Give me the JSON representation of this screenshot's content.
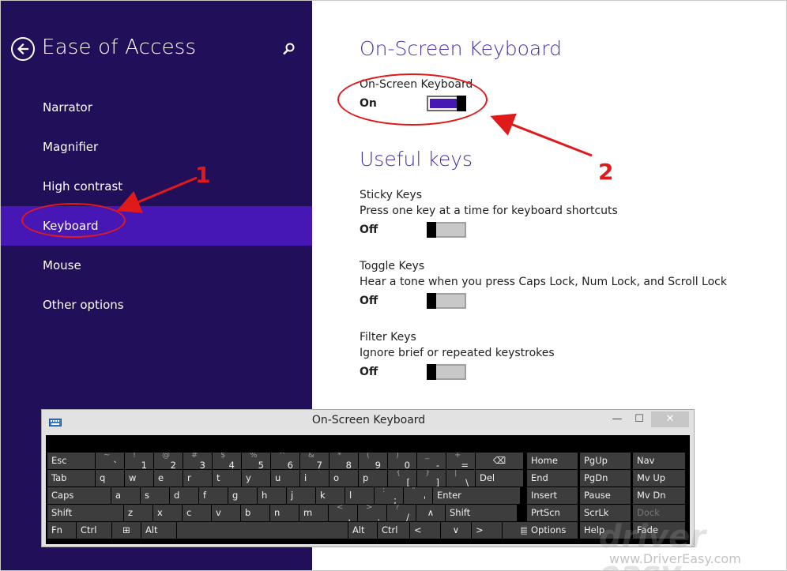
{
  "left_pane": {
    "title": "Ease of Access",
    "nav": [
      {
        "label": "Narrator"
      },
      {
        "label": "Magnifier"
      },
      {
        "label": "High contrast"
      },
      {
        "label": "Keyboard",
        "selected": true
      },
      {
        "label": "Mouse"
      },
      {
        "label": "Other options"
      }
    ]
  },
  "right_pane": {
    "osk_section": {
      "title": "On-Screen Keyboard",
      "label": "On-Screen Keyboard",
      "state": "On"
    },
    "useful_keys": {
      "title": "Useful keys",
      "items": [
        {
          "label": "Sticky Keys",
          "desc": "Press one key at a time for keyboard shortcuts",
          "state": "Off"
        },
        {
          "label": "Toggle Keys",
          "desc": "Hear a tone when you press Caps Lock, Num Lock, and Scroll Lock",
          "state": "Off"
        },
        {
          "label": "Filter Keys",
          "desc": "Ignore brief or repeated keystrokes",
          "state": "Off"
        }
      ]
    }
  },
  "osk_window": {
    "title": "On-Screen Keyboard",
    "rows": [
      [
        {
          "t": "Esc"
        },
        {
          "s": "~",
          "p": "`"
        },
        {
          "s": "!",
          "p": "1"
        },
        {
          "s": "@",
          "p": "2"
        },
        {
          "s": "#",
          "p": "3"
        },
        {
          "s": "$",
          "p": "4"
        },
        {
          "s": "%",
          "p": "5"
        },
        {
          "s": "^",
          "p": "6"
        },
        {
          "s": "&",
          "p": "7"
        },
        {
          "s": "*",
          "p": "8"
        },
        {
          "s": "(",
          "p": "9"
        },
        {
          "s": ")",
          "p": "0"
        },
        {
          "s": "_",
          "p": "-"
        },
        {
          "s": "+",
          "p": "="
        },
        {
          "t": "⌫"
        }
      ],
      [
        {
          "t": "Tab"
        },
        {
          "t": "q"
        },
        {
          "t": "w"
        },
        {
          "t": "e"
        },
        {
          "t": "r"
        },
        {
          "t": "t"
        },
        {
          "t": "y"
        },
        {
          "t": "u"
        },
        {
          "t": "i"
        },
        {
          "t": "o"
        },
        {
          "t": "p"
        },
        {
          "s": "{",
          "p": "["
        },
        {
          "s": "}",
          "p": "]"
        },
        {
          "s": "|",
          "p": "\\"
        },
        {
          "t": "Del"
        }
      ],
      [
        {
          "t": "Caps"
        },
        {
          "t": "a"
        },
        {
          "t": "s"
        },
        {
          "t": "d"
        },
        {
          "t": "f"
        },
        {
          "t": "g"
        },
        {
          "t": "h"
        },
        {
          "t": "j"
        },
        {
          "t": "k"
        },
        {
          "t": "l"
        },
        {
          "s": ":",
          "p": ";"
        },
        {
          "s": "\"",
          "p": "'"
        },
        {
          "t": "Enter"
        }
      ],
      [
        {
          "t": "Shift"
        },
        {
          "t": "z"
        },
        {
          "t": "x"
        },
        {
          "t": "c"
        },
        {
          "t": "v"
        },
        {
          "t": "b"
        },
        {
          "t": "n"
        },
        {
          "t": "m"
        },
        {
          "s": "<",
          "p": ","
        },
        {
          "s": ">",
          "p": "."
        },
        {
          "s": "?",
          "p": "/"
        },
        {
          "t": "∧"
        },
        {
          "t": "Shift"
        }
      ],
      [
        {
          "t": "Fn"
        },
        {
          "t": "Ctrl"
        },
        {
          "t": "⊞"
        },
        {
          "t": "Alt"
        },
        {
          "t": ""
        },
        {
          "t": "Alt"
        },
        {
          "t": "Ctrl"
        },
        {
          "t": "<"
        },
        {
          "t": "∨"
        },
        {
          "t": ">"
        },
        {
          "t": "▤"
        }
      ]
    ],
    "nav_keys": [
      [
        "Home",
        "PgUp",
        "Nav"
      ],
      [
        "End",
        "PgDn",
        "Mv Up"
      ],
      [
        "Insert",
        "Pause",
        "Mv Dn"
      ],
      [
        "PrtScn",
        "ScrLk",
        "Dock"
      ],
      [
        "Options",
        "Help",
        "Fade"
      ]
    ]
  },
  "annotations": {
    "step1": "1",
    "step2": "2"
  },
  "watermark": {
    "logo": "driver easy",
    "url": "www.DriverEasy.com"
  }
}
